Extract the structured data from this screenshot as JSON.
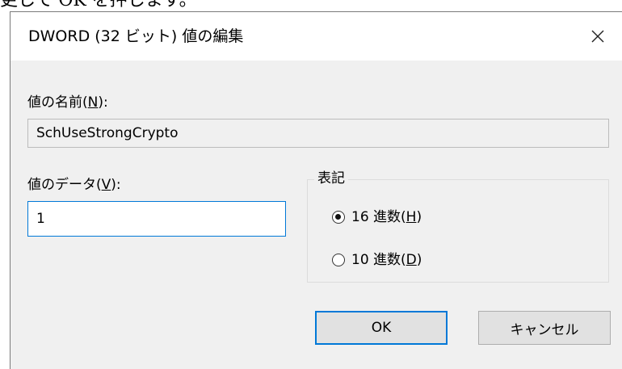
{
  "page_caption": "更して OK を押します。",
  "dialog": {
    "title": "DWORD (32 ビット) 値の編集",
    "close_icon": "close-icon"
  },
  "value_name": {
    "label_prefix": "値の名前(",
    "label_accel": "N",
    "label_suffix": "):",
    "value": "SchUseStrongCrypto"
  },
  "value_data": {
    "label_prefix": "値のデータ(",
    "label_accel": "V",
    "label_suffix": "):",
    "value": "1"
  },
  "base": {
    "legend": "表記",
    "options": [
      {
        "prefix": "16 進数(",
        "accel": "H",
        "suffix": ")",
        "selected": true
      },
      {
        "prefix": "10 進数(",
        "accel": "D",
        "suffix": ")",
        "selected": false
      }
    ]
  },
  "buttons": {
    "ok": "OK",
    "cancel": "キャンセル"
  },
  "colors": {
    "accent": "#0078d7",
    "dialog_body": "#f0f0f0"
  }
}
